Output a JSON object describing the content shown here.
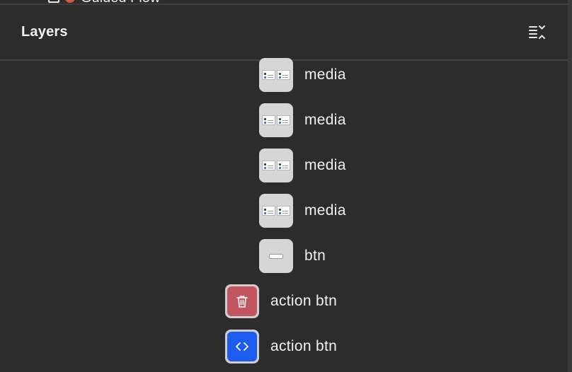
{
  "clipped_row": {
    "label": "Guided Flow",
    "icons": [
      "layout-grid-icon",
      "rocket-icon"
    ]
  },
  "panel": {
    "title": "Layers",
    "collapse_icon": "collapse-all-icon"
  },
  "layers": [
    {
      "label": "media",
      "icon": "media-thumbnail"
    },
    {
      "label": "media",
      "icon": "media-thumbnail"
    },
    {
      "label": "media",
      "icon": "media-thumbnail"
    },
    {
      "label": "media",
      "icon": "media-thumbnail"
    },
    {
      "label": "btn",
      "icon": "button-thumbnail"
    },
    {
      "label": "action btn",
      "icon": "trash-icon",
      "accent": "#c2555f"
    },
    {
      "label": "action btn",
      "icon": "code-icon",
      "accent": "#1e5cf0"
    }
  ]
}
